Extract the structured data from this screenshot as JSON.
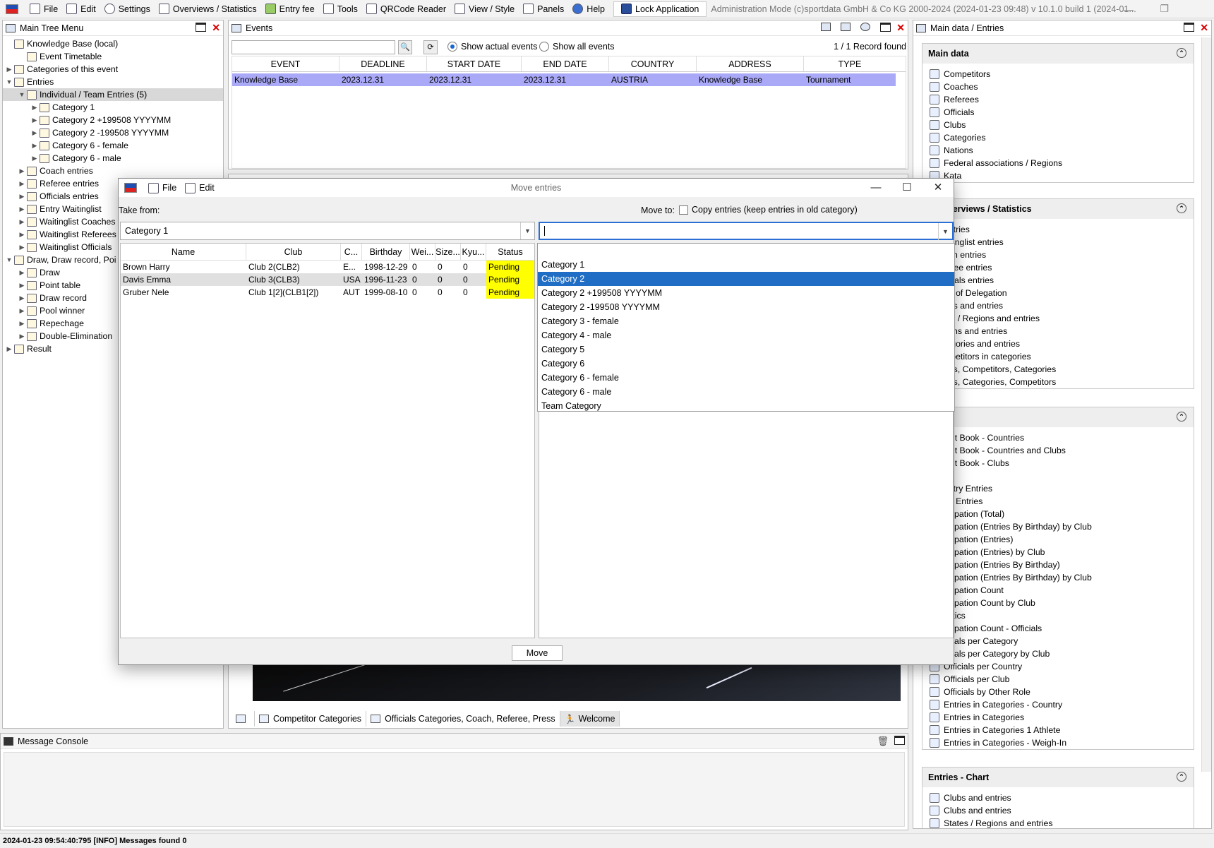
{
  "menu": {
    "items": [
      "File",
      "Edit",
      "Settings",
      "Overviews / Statistics",
      "Entry fee",
      "Tools",
      "QRCode Reader",
      "View / Style",
      "Panels",
      "Help"
    ],
    "lock": "Lock Application",
    "admin_text": "Administration Mode (c)sportdata GmbH & Co KG 2000-2024 (2024-01-23 09:48)  v 10.1.0 build 1 (2024-01..."
  },
  "tree_panel": {
    "title": "Main Tree Menu",
    "items": [
      {
        "label": "Knowledge Base (local)",
        "level": 0,
        "arrow": ""
      },
      {
        "label": "Event Timetable",
        "level": 1,
        "arrow": ""
      },
      {
        "label": "Categories of this event",
        "level": 0,
        "arrow": "▶"
      },
      {
        "label": "Entries",
        "level": 0,
        "arrow": "▼"
      },
      {
        "label": "Individual / Team Entries (5)",
        "level": 1,
        "arrow": "▼",
        "selected": true
      },
      {
        "label": "Category 1",
        "level": 2,
        "arrow": "▶"
      },
      {
        "label": "Category 2 +199508 YYYYMM",
        "level": 2,
        "arrow": "▶"
      },
      {
        "label": "Category 2 -199508 YYYYMM",
        "level": 2,
        "arrow": "▶"
      },
      {
        "label": "Category 6 - female",
        "level": 2,
        "arrow": "▶"
      },
      {
        "label": "Category 6 - male",
        "level": 2,
        "arrow": "▶"
      },
      {
        "label": "Coach entries",
        "level": 1,
        "arrow": "▶"
      },
      {
        "label": "Referee entries",
        "level": 1,
        "arrow": "▶"
      },
      {
        "label": "Officials entries",
        "level": 1,
        "arrow": "▶"
      },
      {
        "label": "Entry Waitinglist",
        "level": 1,
        "arrow": "▶"
      },
      {
        "label": "Waitinglist Coaches",
        "level": 1,
        "arrow": "▶"
      },
      {
        "label": "Waitinglist Referees",
        "level": 1,
        "arrow": "▶"
      },
      {
        "label": "Waitinglist Officials",
        "level": 1,
        "arrow": "▶"
      },
      {
        "label": "Draw, Draw record, Poi",
        "level": 0,
        "arrow": "▼"
      },
      {
        "label": "Draw",
        "level": 1,
        "arrow": "▶"
      },
      {
        "label": "Point table",
        "level": 1,
        "arrow": "▶"
      },
      {
        "label": "Draw record",
        "level": 1,
        "arrow": "▶"
      },
      {
        "label": "Pool winner",
        "level": 1,
        "arrow": "▶"
      },
      {
        "label": "Repechage",
        "level": 1,
        "arrow": "▶"
      },
      {
        "label": "Double-Elimination",
        "level": 1,
        "arrow": "▶"
      },
      {
        "label": "Result",
        "level": 0,
        "arrow": "▶"
      }
    ]
  },
  "events_panel": {
    "title": "Events",
    "radio_actual": "Show actual events",
    "radio_all": "Show all events",
    "records": "1 / 1 Record found",
    "columns": [
      "EVENT",
      "DEADLINE",
      "START DATE",
      "END DATE",
      "COUNTRY",
      "ADDRESS",
      "TYPE"
    ],
    "row": [
      "Knowledge Base",
      "2023.12.31",
      "2023.12.31",
      "2023.12.31",
      "AUSTRIA",
      "Knowledge Base",
      "Tournament"
    ]
  },
  "right_panel": {
    "title": "Main data / Entries",
    "sections": [
      {
        "title": "Main data",
        "items": [
          "Competitors",
          "Coaches",
          "Referees",
          "Officials",
          "Clubs",
          "Categories",
          "Nations",
          "Federal associations / Regions",
          "Kata"
        ]
      },
      {
        "title": "s - Overviews / Statistics",
        "items": [
          "entries",
          "aitinglist entries",
          "ach entries",
          "feree entries",
          "ficials entries",
          "ad of Delegation",
          "ubs and entries",
          "tes / Regions and entries",
          "tions and entries",
          "tegories and entries",
          "mpetitors in categories",
          "ubs, Competitors, Categories",
          "ubs, Categories, Competitors"
        ]
      },
      {
        "title": "ts",
        "items": [
          "sult Book - Countries",
          "sult Book - Countries and Clubs",
          "sult Book - Clubs",
          "",
          "untry Entries",
          "ub Entries",
          "ticipation (Total)",
          "ticipation (Entries By Birthday) by Club",
          "ticipation (Entries)",
          "ticipation (Entries) by Club",
          "ticipation (Entries By Birthday)",
          "ticipation (Entries By Birthday) by Club",
          "ticipation Count",
          "ticipation Count by Club",
          "tistics",
          "ticipation Count - Officials",
          "ficials per Category",
          "ficials per Category by Club",
          "Officials per Country",
          "Officials per Club",
          "Officials by Other Role",
          "Entries in Categories - Country",
          "Entries in Categories",
          "Entries in Categories 1 Athlete",
          "Entries in Categories - Weigh-In"
        ]
      },
      {
        "title": "Entries - Chart",
        "items": [
          "Clubs and entries",
          "Clubs and entries",
          "States / Regions and entries"
        ]
      }
    ]
  },
  "bottom_tabs": [
    "Competitor Categories",
    "Officials Categories, Coach, Referee, Press",
    "Welcome"
  ],
  "console": {
    "title": "Message Console"
  },
  "status": "2024-01-23 09:54:40:795 [INFO] Messages found 0",
  "dialog": {
    "title": "Move entries",
    "menu": [
      "File",
      "Edit"
    ],
    "take_from_label": "Take from:",
    "move_to_label": "Move to:",
    "copy_label": "Copy entries (keep entries in old category)",
    "from_value": "Category 1",
    "to_value": "",
    "columns": [
      "Name",
      "Club",
      "C...",
      "Birthday",
      "Wei...",
      "Size...",
      "Kyu...",
      "Status"
    ],
    "rows": [
      [
        "Brown Harry",
        "Club 2(CLB2)",
        "E...",
        "1998-12-29",
        "0",
        "0",
        "0",
        "Pending"
      ],
      [
        "Davis Emma",
        "Club 3(CLB3)",
        "USA",
        "1996-11-23",
        "0",
        "0",
        "0",
        "Pending"
      ],
      [
        "Gruber Nele",
        "Club 1[2](CLB1[2])",
        "AUT",
        "1999-08-10",
        "0",
        "0",
        "0",
        "Pending"
      ]
    ],
    "options": [
      "Category 1",
      "Category 2",
      "Category 2 +199508 YYYYMM",
      "Category 2 -199508 YYYYMM",
      "Category 3 - female",
      "Category 4 - male",
      "Category 5",
      "Category 6",
      "Category 6 - female",
      "Category 6 - male",
      "Team Category"
    ],
    "highlighted_option": "Category 2",
    "move_button": "Move"
  }
}
